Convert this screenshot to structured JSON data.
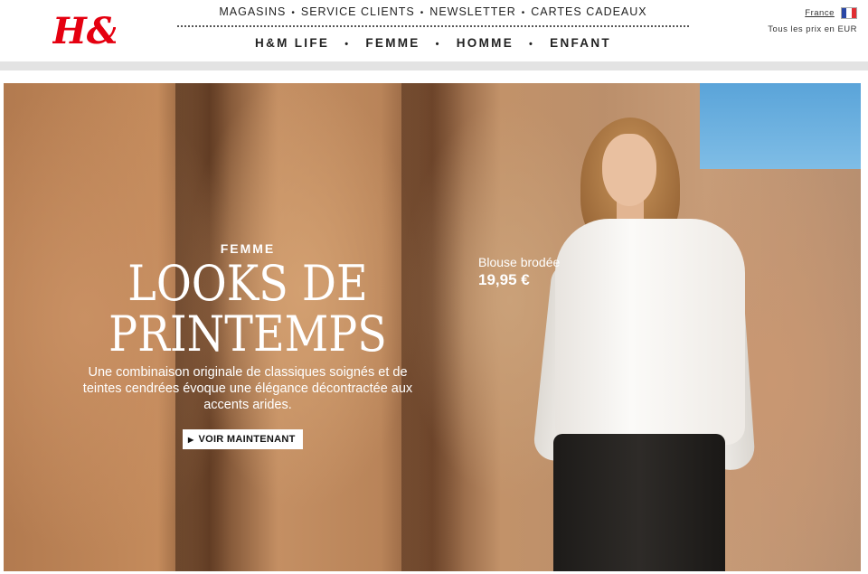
{
  "brand": {
    "logo_text": "H&M",
    "color": "#e50010"
  },
  "top_nav": [
    "MAGASINS",
    "SERVICE CLIENTS",
    "NEWSLETTER",
    "CARTES CADEAUX"
  ],
  "main_nav": [
    "H&M LIFE",
    "FEMME",
    "HOMME",
    "ENFANT"
  ],
  "nav_separator": "•",
  "locale": {
    "country": "France",
    "currency_note": "Tous les prix en EUR"
  },
  "hero": {
    "category": "FEMME",
    "headline_line1": "LOOKS DE",
    "headline_line2": "PRINTEMPS",
    "description": "Une combinaison originale de classiques soignés et de teintes cendrées évoque une élégance décontractée aux accents arides.",
    "cta_label": "VOIR MAINTENANT",
    "product_name": "Blouse brodée",
    "product_price": "19,95 €"
  }
}
